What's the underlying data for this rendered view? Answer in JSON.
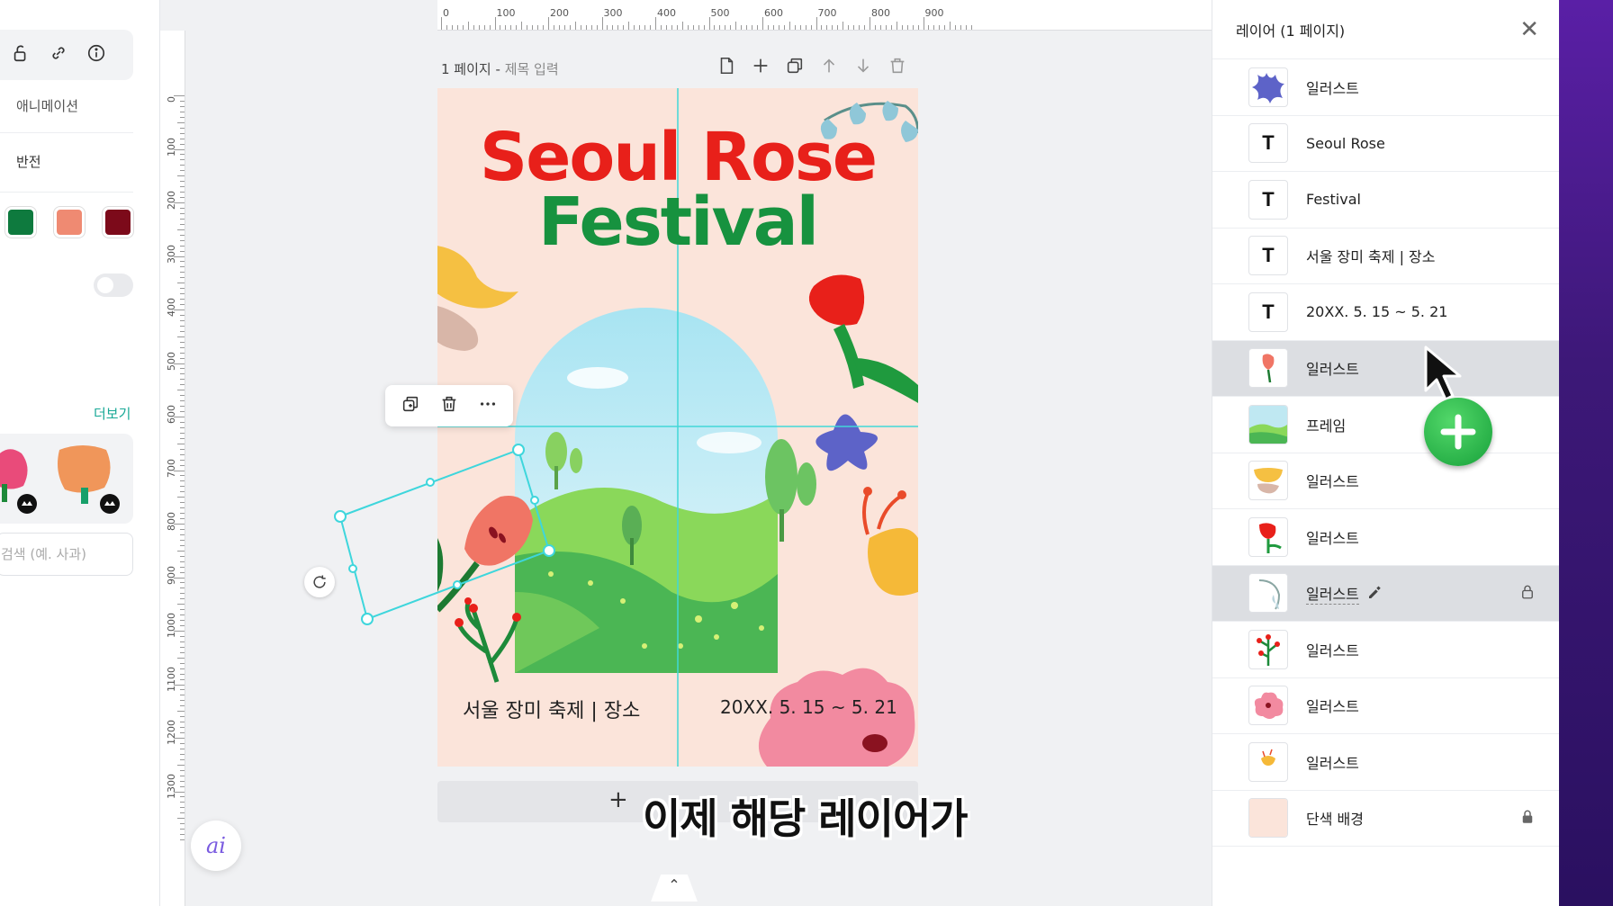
{
  "left_panel": {
    "animation_label": "애니메이션",
    "flip_label": "반전",
    "swatches": [
      "#0e7a3e",
      "#ef8a72",
      "#7c0a1a"
    ],
    "more_link": "더보기",
    "search_placeholder": "검색 (예. 사과)"
  },
  "rulers": {
    "top": [
      "0",
      "100",
      "200",
      "300",
      "400",
      "500",
      "600",
      "700",
      "800",
      "900"
    ],
    "left": [
      "0",
      "100",
      "200",
      "300",
      "400",
      "500",
      "600",
      "700",
      "800",
      "900",
      "1000",
      "1100",
      "1200",
      "1300"
    ]
  },
  "page": {
    "number_label": "1 페이지 -",
    "title_placeholder": "제목 입력"
  },
  "poster": {
    "title_line1": "Seoul Rose",
    "title_line2": "Festival",
    "info_left": "서울 장미 축제 | 장소",
    "info_right": "20XX. 5. 15 ~ 5. 21"
  },
  "subtitle": "이제 해당 레이어가",
  "ai_label": "ai",
  "layers_panel": {
    "title": "레이어 (1 페이지)",
    "layers": [
      {
        "label": "일러스트",
        "thumb": "purple-flower",
        "type": "image"
      },
      {
        "label": "Seoul Rose",
        "thumb": "T",
        "type": "text"
      },
      {
        "label": "Festival",
        "thumb": "T",
        "type": "text"
      },
      {
        "label": "서울 장미 축제 | 장소",
        "thumb": "T",
        "type": "text"
      },
      {
        "label": "20XX. 5. 15 ~ 5. 21",
        "thumb": "T",
        "type": "text"
      },
      {
        "label": "일러스트",
        "thumb": "pink-tulip",
        "type": "image",
        "selected": true
      },
      {
        "label": "프레임",
        "thumb": "landscape",
        "type": "image"
      },
      {
        "label": "일러스트",
        "thumb": "yellow-flower",
        "type": "image"
      },
      {
        "label": "일러스트",
        "thumb": "red-tulip",
        "type": "image"
      },
      {
        "label": "일러스트",
        "thumb": "bluebell",
        "type": "image",
        "selected": true,
        "editing": true,
        "lock": "unlocked"
      },
      {
        "label": "일러스트",
        "thumb": "red-branch",
        "type": "image"
      },
      {
        "label": "일러스트",
        "thumb": "pink-flower",
        "type": "image"
      },
      {
        "label": "일러스트",
        "thumb": "yellow-small",
        "type": "image"
      },
      {
        "label": "단색 배경",
        "thumb": "solid-bg",
        "type": "image",
        "lock": "locked"
      }
    ]
  },
  "colors": {
    "title_red": "#e8201a",
    "title_green": "#17923f",
    "poster_bg": "#fbe4da",
    "guide_cyan": "#41d8d8",
    "accent_teal": "#17a896"
  }
}
